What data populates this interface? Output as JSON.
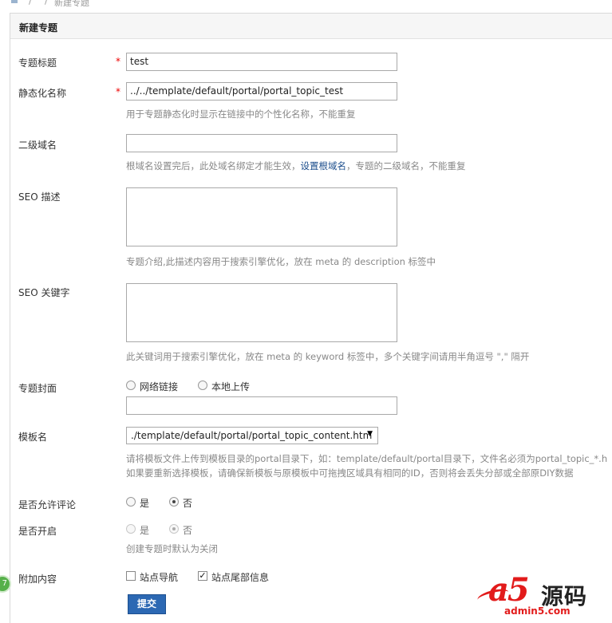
{
  "breadcrumb": {
    "sep1": "/",
    "sep2": "/",
    "current": "新建专题"
  },
  "panel": {
    "title": "新建专题"
  },
  "form": {
    "title": {
      "label": "专题标题",
      "required_mark": "*",
      "value": "test"
    },
    "static_name": {
      "label": "静态化名称",
      "required_mark": "*",
      "value": "../../template/default/portal/portal_topic_test",
      "hint": "用于专题静态化时显示在链接中的个性化名称，不能重复"
    },
    "subdomain": {
      "label": "二级域名",
      "value": "",
      "hint_before": "根域名设置完后，此处域名绑定才能生效，",
      "hint_link": "设置根域名",
      "hint_after": "，专题的二级域名，不能重复"
    },
    "seo_desc": {
      "label": "SEO 描述",
      "value": "",
      "hint": "专题介绍,此描述内容用于搜索引擎优化，放在 meta 的 description 标签中"
    },
    "seo_keywords": {
      "label": "SEO 关键字",
      "value": "",
      "hint": "此关键词用于搜索引擎优化，放在 meta 的 keyword 标签中，多个关键字间请用半角逗号 \",\" 隔开"
    },
    "cover": {
      "label": "专题封面",
      "opt_link": "网络链接",
      "opt_upload": "本地上传",
      "value": ""
    },
    "template": {
      "label": "模板名",
      "selected": "./template/default/portal/portal_topic_content.htm",
      "hint1": "请将模板文件上传到模板目录的portal目录下，如：template/default/portal目录下，文件名必须为portal_topic_*.h",
      "hint2": "如果要重新选择模板，请确保新模板与原模板中可拖拽区域具有相同的ID，否则将会丢失分部或全部原DIY数据"
    },
    "allow_comment": {
      "label": "是否允许评论",
      "yes": "是",
      "no": "否",
      "selected": "否"
    },
    "enabled": {
      "label": "是否开启",
      "yes": "是",
      "no": "否",
      "selected": "否",
      "hint": "创建专题时默认为关闭"
    },
    "extra": {
      "label": "附加内容",
      "opt_nav": "站点导航",
      "opt_footer": "站点尾部信息",
      "nav_checked": false,
      "footer_checked": true
    },
    "submit_label": "提交"
  },
  "side_badge": "7",
  "watermark": {
    "big": "a5",
    "cn": "源码",
    "domain": "admin5.com"
  },
  "icons": [
    "home-icon",
    "select-arrow-icon",
    "radio-icon",
    "checkbox-icon"
  ],
  "colors": {
    "accent": "#2c68b3",
    "required": "#e00000",
    "link": "#1a4c8b",
    "watermark": "#e21b1b"
  }
}
